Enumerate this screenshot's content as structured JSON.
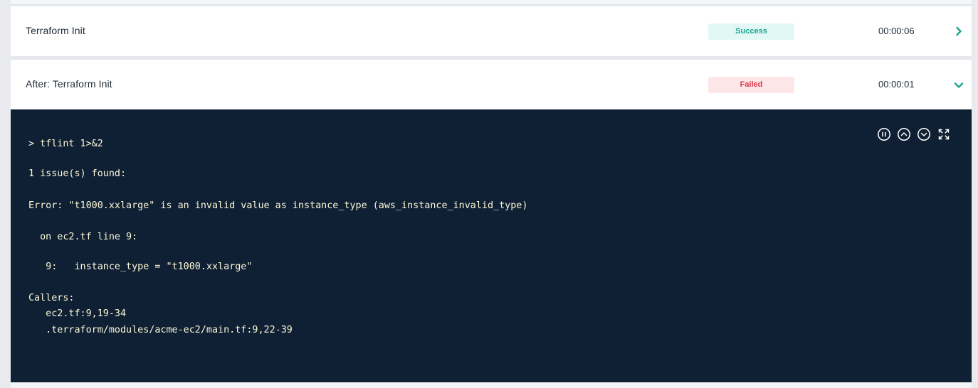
{
  "steps": [
    {
      "name": "Terraform Init",
      "status": "Success",
      "duration": "00:00:06",
      "expander": "chevron-right-icon"
    },
    {
      "name": "After: Terraform Init",
      "status": "Failed",
      "duration": "00:00:01",
      "expander": "chevron-down-icon"
    }
  ],
  "console": {
    "controls": [
      "pause-icon",
      "scroll-up-icon",
      "scroll-down-icon",
      "expand-icon"
    ],
    "lines": [
      "> tflint 1>&2",
      "1 issue(s) found:",
      "Error: \"t1000.xxlarge\" is an invalid value as instance_type (aws_instance_invalid_type)",
      "  on ec2.tf line 9:",
      "   9:   instance_type = \"t1000.xxlarge\"",
      "Callers:",
      "   ec2.tf:9,19-34",
      "   .terraform/modules/acme-ec2/main.tf:9,22-39"
    ]
  },
  "colors": {
    "accent": "#1aa490",
    "success_bg": "#e2f8f5",
    "failed_text": "#d8394c",
    "failed_bg": "#fde6e8",
    "console_bg": "#0f2034",
    "console_text": "#fdf7d8"
  }
}
